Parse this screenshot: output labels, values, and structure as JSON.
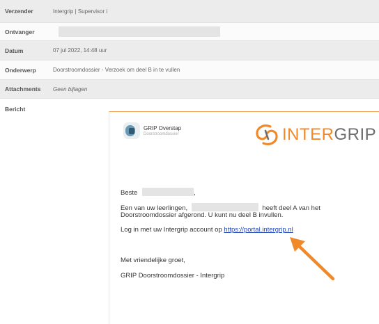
{
  "meta": {
    "sender": {
      "label": "Verzender",
      "value": "Intergrip | Supervisor i"
    },
    "recipient": {
      "label": "Ontvanger"
    },
    "date": {
      "label": "Datum",
      "value": "07 jul 2022, 14:48 uur"
    },
    "subject": {
      "label": "Onderwerp",
      "value": "Doorstroomdossier - Verzoek om deel B in te vullen"
    },
    "attachments": {
      "label": "Attachments",
      "value": "Geen bijlagen"
    },
    "message": {
      "label": "Bericht"
    }
  },
  "email": {
    "grip_title": "GRIP Overstap",
    "grip_subtitle": "Doorstroomdossier",
    "intergrip_inter": "INTER",
    "intergrip_grip": "GRIP",
    "greeting": "Beste",
    "greeting_comma": ",",
    "para1_a": "Een van uw leerlingen,",
    "para1_b": "heeft deel A van het",
    "para1_c": "Doorstroomdossier afgerond. U kunt nu deel B invullen.",
    "login_text": "Log in met uw Intergrip account op",
    "login_link": "https://portal.intergrip.nl",
    "closing": "Met vriendelijke groet,",
    "signature": "GRIP Doorstroomdossier - Intergrip"
  },
  "colors": {
    "accent_orange": "#f0892a",
    "link_blue": "#2346b5",
    "row_shade": "#ececec"
  }
}
